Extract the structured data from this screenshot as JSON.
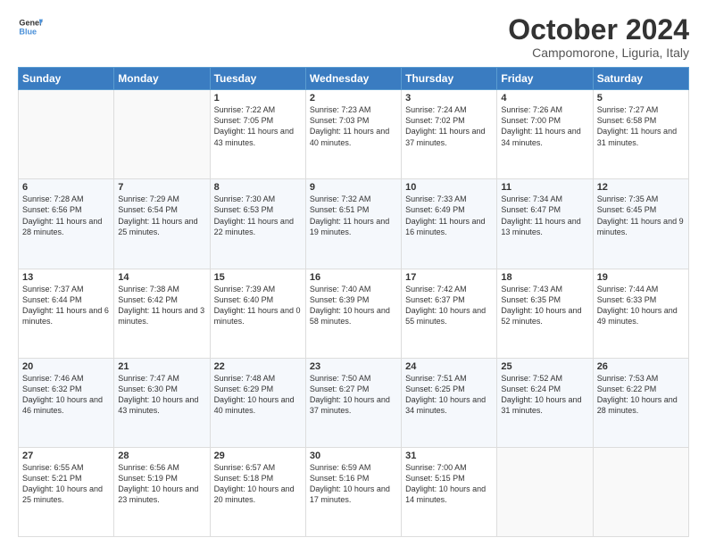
{
  "header": {
    "logo_line1": "General",
    "logo_line2": "Blue",
    "month": "October 2024",
    "location": "Campomorone, Liguria, Italy"
  },
  "days": [
    "Sunday",
    "Monday",
    "Tuesday",
    "Wednesday",
    "Thursday",
    "Friday",
    "Saturday"
  ],
  "weeks": [
    [
      null,
      null,
      {
        "day": 1,
        "sunrise": "7:22 AM",
        "sunset": "7:05 PM",
        "daylight": "11 hours and 43 minutes."
      },
      {
        "day": 2,
        "sunrise": "7:23 AM",
        "sunset": "7:03 PM",
        "daylight": "11 hours and 40 minutes."
      },
      {
        "day": 3,
        "sunrise": "7:24 AM",
        "sunset": "7:02 PM",
        "daylight": "11 hours and 37 minutes."
      },
      {
        "day": 4,
        "sunrise": "7:26 AM",
        "sunset": "7:00 PM",
        "daylight": "11 hours and 34 minutes."
      },
      {
        "day": 5,
        "sunrise": "7:27 AM",
        "sunset": "6:58 PM",
        "daylight": "11 hours and 31 minutes."
      }
    ],
    [
      {
        "day": 6,
        "sunrise": "7:28 AM",
        "sunset": "6:56 PM",
        "daylight": "11 hours and 28 minutes."
      },
      {
        "day": 7,
        "sunrise": "7:29 AM",
        "sunset": "6:54 PM",
        "daylight": "11 hours and 25 minutes."
      },
      {
        "day": 8,
        "sunrise": "7:30 AM",
        "sunset": "6:53 PM",
        "daylight": "11 hours and 22 minutes."
      },
      {
        "day": 9,
        "sunrise": "7:32 AM",
        "sunset": "6:51 PM",
        "daylight": "11 hours and 19 minutes."
      },
      {
        "day": 10,
        "sunrise": "7:33 AM",
        "sunset": "6:49 PM",
        "daylight": "11 hours and 16 minutes."
      },
      {
        "day": 11,
        "sunrise": "7:34 AM",
        "sunset": "6:47 PM",
        "daylight": "11 hours and 13 minutes."
      },
      {
        "day": 12,
        "sunrise": "7:35 AM",
        "sunset": "6:45 PM",
        "daylight": "11 hours and 9 minutes."
      }
    ],
    [
      {
        "day": 13,
        "sunrise": "7:37 AM",
        "sunset": "6:44 PM",
        "daylight": "11 hours and 6 minutes."
      },
      {
        "day": 14,
        "sunrise": "7:38 AM",
        "sunset": "6:42 PM",
        "daylight": "11 hours and 3 minutes."
      },
      {
        "day": 15,
        "sunrise": "7:39 AM",
        "sunset": "6:40 PM",
        "daylight": "11 hours and 0 minutes."
      },
      {
        "day": 16,
        "sunrise": "7:40 AM",
        "sunset": "6:39 PM",
        "daylight": "10 hours and 58 minutes."
      },
      {
        "day": 17,
        "sunrise": "7:42 AM",
        "sunset": "6:37 PM",
        "daylight": "10 hours and 55 minutes."
      },
      {
        "day": 18,
        "sunrise": "7:43 AM",
        "sunset": "6:35 PM",
        "daylight": "10 hours and 52 minutes."
      },
      {
        "day": 19,
        "sunrise": "7:44 AM",
        "sunset": "6:33 PM",
        "daylight": "10 hours and 49 minutes."
      }
    ],
    [
      {
        "day": 20,
        "sunrise": "7:46 AM",
        "sunset": "6:32 PM",
        "daylight": "10 hours and 46 minutes."
      },
      {
        "day": 21,
        "sunrise": "7:47 AM",
        "sunset": "6:30 PM",
        "daylight": "10 hours and 43 minutes."
      },
      {
        "day": 22,
        "sunrise": "7:48 AM",
        "sunset": "6:29 PM",
        "daylight": "10 hours and 40 minutes."
      },
      {
        "day": 23,
        "sunrise": "7:50 AM",
        "sunset": "6:27 PM",
        "daylight": "10 hours and 37 minutes."
      },
      {
        "day": 24,
        "sunrise": "7:51 AM",
        "sunset": "6:25 PM",
        "daylight": "10 hours and 34 minutes."
      },
      {
        "day": 25,
        "sunrise": "7:52 AM",
        "sunset": "6:24 PM",
        "daylight": "10 hours and 31 minutes."
      },
      {
        "day": 26,
        "sunrise": "7:53 AM",
        "sunset": "6:22 PM",
        "daylight": "10 hours and 28 minutes."
      }
    ],
    [
      {
        "day": 27,
        "sunrise": "6:55 AM",
        "sunset": "5:21 PM",
        "daylight": "10 hours and 25 minutes."
      },
      {
        "day": 28,
        "sunrise": "6:56 AM",
        "sunset": "5:19 PM",
        "daylight": "10 hours and 23 minutes."
      },
      {
        "day": 29,
        "sunrise": "6:57 AM",
        "sunset": "5:18 PM",
        "daylight": "10 hours and 20 minutes."
      },
      {
        "day": 30,
        "sunrise": "6:59 AM",
        "sunset": "5:16 PM",
        "daylight": "10 hours and 17 minutes."
      },
      {
        "day": 31,
        "sunrise": "7:00 AM",
        "sunset": "5:15 PM",
        "daylight": "10 hours and 14 minutes."
      },
      null,
      null
    ]
  ],
  "labels": {
    "sunrise": "Sunrise:",
    "sunset": "Sunset:",
    "daylight": "Daylight:"
  }
}
